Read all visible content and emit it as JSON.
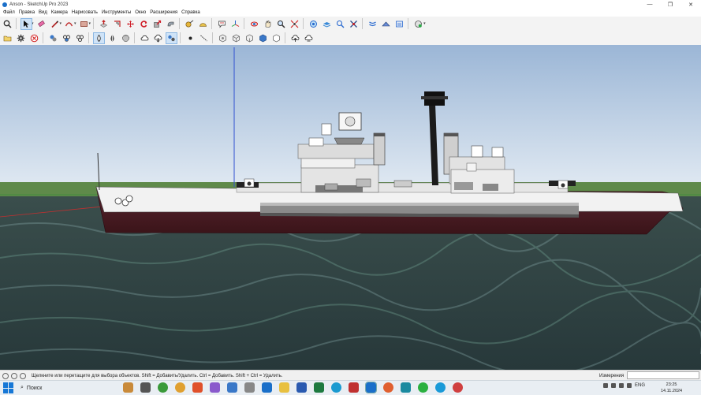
{
  "window": {
    "title": "Anson - SketchUp Pro 2023",
    "controls": [
      "—",
      "❐",
      "✕"
    ]
  },
  "menu": [
    "Файл",
    "Правка",
    "Вид",
    "Камера",
    "Нарисовать",
    "Инструменты",
    "Окно",
    "Расширения",
    "Справка"
  ],
  "toolbar_row1": [
    "search-icon",
    "select-arrow-icon",
    "eraser-icon",
    "line-pencil-icon",
    "arc-icon",
    "rectangle-icon",
    "push-pull-icon",
    "offset-icon",
    "move-icon",
    "rotate-icon",
    "scale-icon",
    "follow-me-icon",
    "tape-measure-icon",
    "protractor-icon",
    "text-icon",
    "axes-icon",
    "orbit-icon",
    "pan-icon",
    "zoom-icon",
    "zoom-extents-icon",
    "section-plane-icon",
    "add-location-icon"
  ],
  "toolbar_row2": [
    "open-folder-icon",
    "gear-icon",
    "close-circle-icon",
    "components-icon",
    "materials-icon",
    "styles-icon",
    "xray-icon",
    "back-edges-icon",
    "wireframe-icon",
    "upload-icon",
    "download-icon",
    "share-icon",
    "dot-icon",
    "dimensions-icon",
    "iso-view-icon",
    "top-view-icon",
    "front-view-icon",
    "right-view-icon",
    "back-view-icon",
    "cloud-upload-icon",
    "cloud-download-icon"
  ],
  "status": {
    "hint": "Щелкните или перетащите для выбора объектов. Shift = Добавить/Удалить. Ctrl = Добавить. Shift + Ctrl = Удалить.",
    "measurements_label": "Измерения",
    "measurements_value": ""
  },
  "taskbar": {
    "search_placeholder": "Поиск",
    "lang": "ENG",
    "time": "23:25",
    "date": "14.11.2024"
  },
  "colors": {
    "sky_top": "#9db8d8",
    "sky_bottom": "#dce7f1",
    "water": "#2f4647",
    "hull_red": "#4a1a22",
    "accent_blue": "#1a6fc9"
  }
}
